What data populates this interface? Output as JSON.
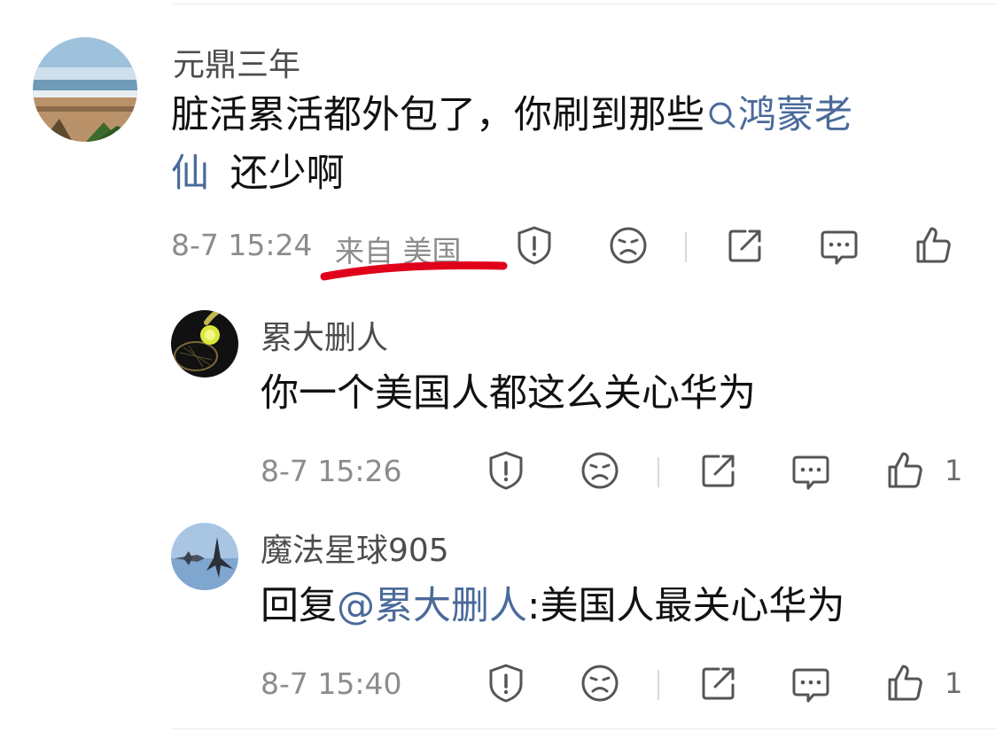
{
  "comment": {
    "username": "元鼎三年",
    "text_before": "脏活累活都外包了，你刷到那些",
    "search_link": "鸿蒙老",
    "search_link_line2": "仙",
    "text_after": "还少啊",
    "time": "8-7 15:24",
    "location": "来自 美国",
    "highlight_color": "#e0001b"
  },
  "replies": [
    {
      "username": "累大删人",
      "text": "你一个美国人都这么关心华为",
      "time": "8-7 15:26",
      "like_count": "1"
    },
    {
      "username": "魔法星球905",
      "reply_prefix": "回复",
      "mention": "@累大删人",
      "text": ":美国人最关心华为",
      "time": "8-7 15:40",
      "like_count": "1"
    }
  ],
  "icons": {
    "report": "report-icon",
    "dislike": "dislike-face-icon",
    "share": "share-icon",
    "comment": "comment-icon",
    "like": "thumbs-up-icon",
    "search": "search-icon"
  },
  "colors": {
    "link": "#4a6a9a",
    "meta": "#8c8c8c",
    "text": "#111111"
  }
}
